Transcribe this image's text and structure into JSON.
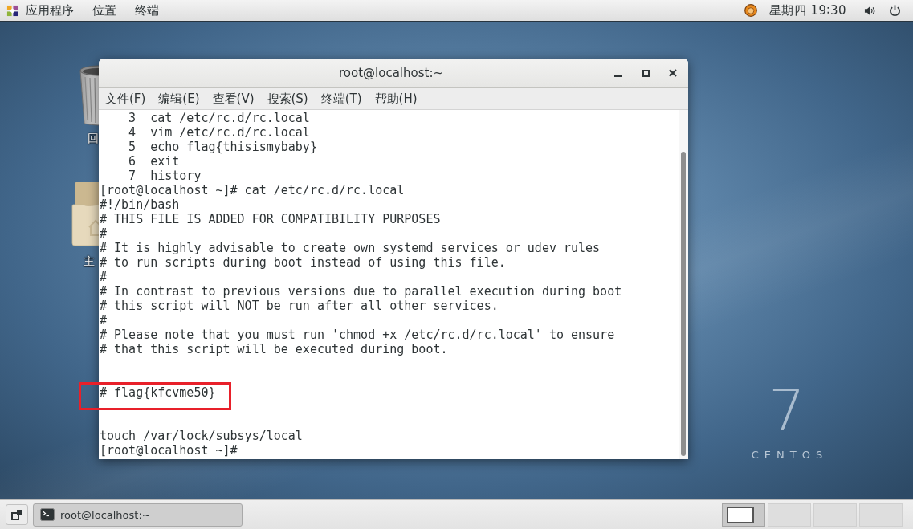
{
  "top_bar": {
    "menus": [
      {
        "kind": "apps",
        "label": "应用程序"
      },
      {
        "kind": "plain",
        "label": "位置"
      },
      {
        "kind": "plain",
        "label": "终端"
      }
    ],
    "clock": "星期四 19∶30"
  },
  "desktop": {
    "icons": [
      {
        "kind": "trash",
        "label": "回"
      },
      {
        "kind": "folder",
        "label": "主"
      }
    ],
    "wallpaper": {
      "numeral": "7",
      "brand": "CENTOS"
    }
  },
  "terminal_window": {
    "title": "root@localhost:~",
    "menu": [
      "文件(F)",
      "编辑(E)",
      "查看(V)",
      "搜索(S)",
      "终端(T)",
      "帮助(H)"
    ],
    "lines": [
      {
        "kind": "text",
        "text": "    3  cat /etc/rc.d/rc.local",
        "highlighted": false
      },
      {
        "kind": "text",
        "text": "    4  vim /etc/rc.d/rc.local",
        "highlighted": false
      },
      {
        "kind": "text",
        "text": "    5  echo flag{thisismybaby}",
        "highlighted": false
      },
      {
        "kind": "text",
        "text": "    6  exit",
        "highlighted": false
      },
      {
        "kind": "text",
        "text": "    7  history",
        "highlighted": false
      },
      {
        "kind": "text",
        "text": "[root@localhost ~]# cat /etc/rc.d/rc.local",
        "highlighted": false
      },
      {
        "kind": "text",
        "text": "#!/bin/bash",
        "highlighted": false
      },
      {
        "kind": "text",
        "text": "# THIS FILE IS ADDED FOR COMPATIBILITY PURPOSES",
        "highlighted": false
      },
      {
        "kind": "text",
        "text": "#",
        "highlighted": false
      },
      {
        "kind": "text",
        "text": "# It is highly advisable to create own systemd services or udev rules",
        "highlighted": false
      },
      {
        "kind": "text",
        "text": "# to run scripts during boot instead of using this file.",
        "highlighted": false
      },
      {
        "kind": "text",
        "text": "#",
        "highlighted": false
      },
      {
        "kind": "text",
        "text": "# In contrast to previous versions due to parallel execution during boot",
        "highlighted": false
      },
      {
        "kind": "text",
        "text": "# this script will NOT be run after all other services.",
        "highlighted": false
      },
      {
        "kind": "text",
        "text": "#",
        "highlighted": false
      },
      {
        "kind": "text",
        "text": "# Please note that you must run 'chmod +x /etc/rc.d/rc.local' to ensure",
        "highlighted": false
      },
      {
        "kind": "text",
        "text": "# that this script will be executed during boot.",
        "highlighted": false
      },
      {
        "kind": "blank"
      },
      {
        "kind": "blank"
      },
      {
        "kind": "text",
        "text": "# flag{kfcvme50}",
        "highlighted": true
      },
      {
        "kind": "blank"
      },
      {
        "kind": "blank"
      },
      {
        "kind": "text",
        "text": "touch /var/lock/subsys/local",
        "highlighted": false
      },
      {
        "kind": "text",
        "text": "[root@localhost ~]#",
        "highlighted": false
      }
    ]
  },
  "taskbar": {
    "window_button": {
      "title": "root@localhost:~",
      "selected": true
    },
    "workspaces": [
      {
        "selected": true,
        "has_window": true
      },
      {
        "selected": false,
        "has_window": false
      },
      {
        "selected": false,
        "has_window": false
      },
      {
        "selected": false,
        "has_window": false
      }
    ]
  }
}
